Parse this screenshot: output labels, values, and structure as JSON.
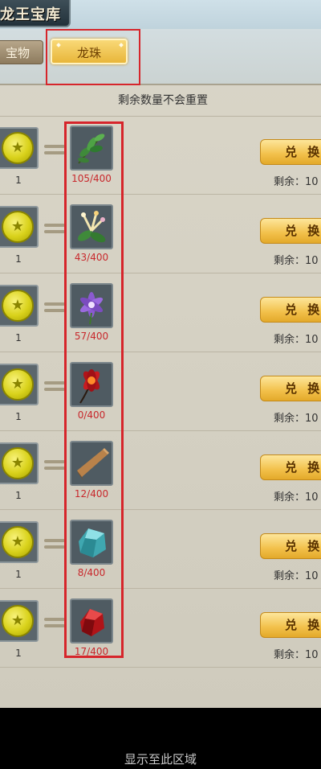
{
  "title": "龙王宝库",
  "tabs": [
    {
      "label": "宝物"
    },
    {
      "label": "龙珠"
    }
  ],
  "notice": "剩余数量不会重置",
  "rows": [
    {
      "cost_qty": "1",
      "item_icon": "green-leaf-branch-icon",
      "count": "105/400",
      "button": "兑 换",
      "remain": "剩余：10"
    },
    {
      "cost_qty": "1",
      "item_icon": "honeysuckle-flower-icon",
      "count": "43/400",
      "button": "兑 换",
      "remain": "剩余：10"
    },
    {
      "cost_qty": "1",
      "item_icon": "purple-lily-flower-icon",
      "count": "57/400",
      "button": "兑 换",
      "remain": "剩余：10"
    },
    {
      "cost_qty": "1",
      "item_icon": "red-lotus-flower-icon",
      "count": "0/400",
      "button": "兑 换",
      "remain": "剩余：10"
    },
    {
      "cost_qty": "1",
      "item_icon": "wood-plank-icon",
      "count": "12/400",
      "button": "兑 换",
      "remain": "剩余：10"
    },
    {
      "cost_qty": "1",
      "item_icon": "cyan-crystal-ore-icon",
      "count": "8/400",
      "button": "兑 换",
      "remain": "剩余：10"
    },
    {
      "cost_qty": "1",
      "item_icon": "red-crystal-gem-icon",
      "count": "17/400",
      "button": "兑 换",
      "remain": "剩余：10"
    }
  ],
  "footer": "显示至此区域",
  "colors": {
    "highlight_red": "#d6252b",
    "count_red": "#c8282c",
    "gold_button": "#f2c04a",
    "coin_yellow": "#d9d21b"
  }
}
